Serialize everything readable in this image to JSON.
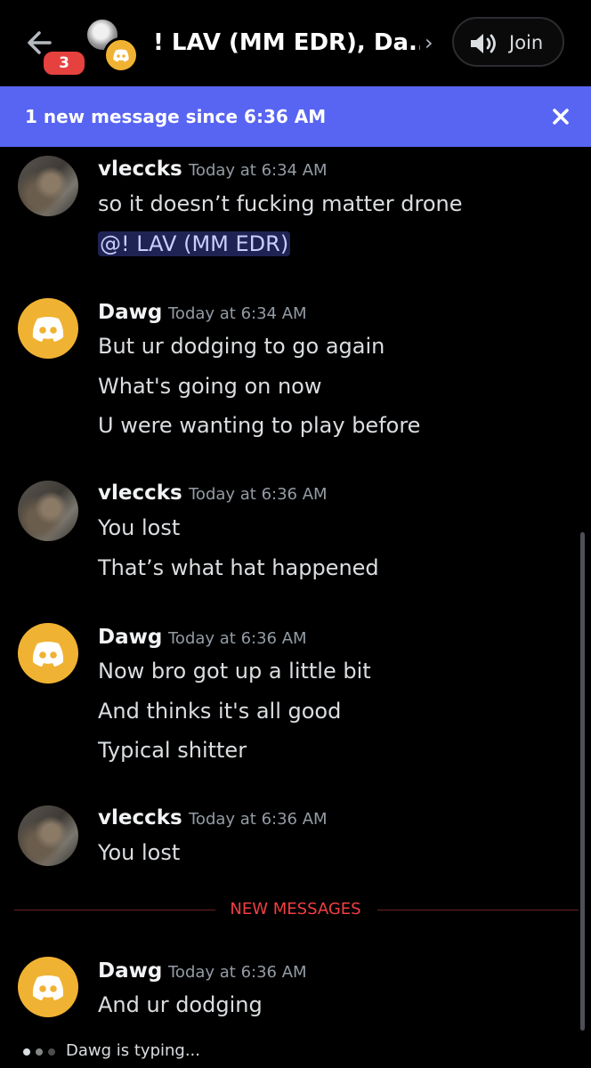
{
  "header": {
    "back_label": "back",
    "unread_count": "3",
    "channel_title": "! LAV (MM EDR), Da...",
    "chevron": "›",
    "join_label": "Join",
    "icons": [
      "arrow-left-icon",
      "speaker-icon",
      "discord-logo-icon"
    ]
  },
  "new_bar": {
    "text": "1 new message since 6:36 AM",
    "close_icon": "close-icon",
    "color": "#5865f2"
  },
  "messages": [
    {
      "author": "vleccks",
      "timestamp": "Today at 6:34 AM",
      "avatar": "photo",
      "lines": [
        "so it doesn’t fucking matter drone"
      ],
      "mention": "@! LAV (MM EDR)"
    },
    {
      "author": "Dawg",
      "timestamp": "Today at 6:34 AM",
      "avatar": "discord",
      "lines": [
        "But ur dodging to go again",
        "What's going on now",
        "U were wanting to play before"
      ]
    },
    {
      "author": "vleccks",
      "timestamp": "Today at 6:36 AM",
      "avatar": "photo",
      "lines": [
        "You lost",
        "That’s what hat happened"
      ]
    },
    {
      "author": "Dawg",
      "timestamp": "Today at 6:36 AM",
      "avatar": "discord",
      "lines": [
        "Now bro got up a little bit",
        "And thinks it's all good",
        "Typical shitter"
      ]
    },
    {
      "author": "vleccks",
      "timestamp": "Today at 6:36 AM",
      "avatar": "photo",
      "lines": [
        "You lost"
      ]
    },
    {
      "author": "Dawg",
      "timestamp": "Today at 6:36 AM",
      "avatar": "discord",
      "lines": [
        "And ur dodging"
      ]
    }
  ],
  "divider": {
    "label": "NEW MESSAGES",
    "color": "#f23f43"
  },
  "typing": {
    "text": "Dawg is typing..."
  },
  "colors": {
    "background": "#000000",
    "discord_avatar": "#f0b232",
    "badge": "#e5413f"
  }
}
